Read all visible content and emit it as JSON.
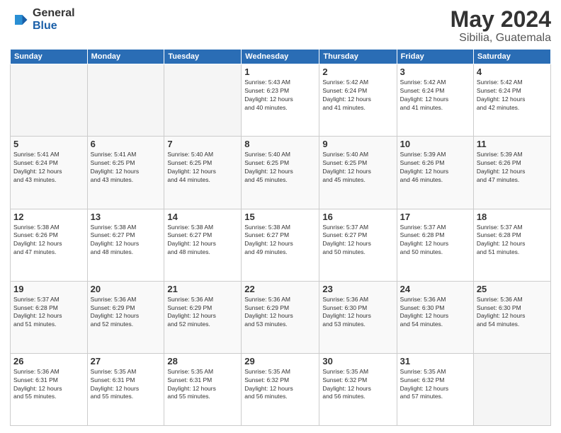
{
  "logo": {
    "general": "General",
    "blue": "Blue"
  },
  "header": {
    "title": "May 2024",
    "subtitle": "Sibilia, Guatemala"
  },
  "weekdays": [
    "Sunday",
    "Monday",
    "Tuesday",
    "Wednesday",
    "Thursday",
    "Friday",
    "Saturday"
  ],
  "weeks": [
    [
      {
        "day": "",
        "info": ""
      },
      {
        "day": "",
        "info": ""
      },
      {
        "day": "",
        "info": ""
      },
      {
        "day": "1",
        "info": "Sunrise: 5:43 AM\nSunset: 6:23 PM\nDaylight: 12 hours\nand 40 minutes."
      },
      {
        "day": "2",
        "info": "Sunrise: 5:42 AM\nSunset: 6:24 PM\nDaylight: 12 hours\nand 41 minutes."
      },
      {
        "day": "3",
        "info": "Sunrise: 5:42 AM\nSunset: 6:24 PM\nDaylight: 12 hours\nand 41 minutes."
      },
      {
        "day": "4",
        "info": "Sunrise: 5:42 AM\nSunset: 6:24 PM\nDaylight: 12 hours\nand 42 minutes."
      }
    ],
    [
      {
        "day": "5",
        "info": "Sunrise: 5:41 AM\nSunset: 6:24 PM\nDaylight: 12 hours\nand 43 minutes."
      },
      {
        "day": "6",
        "info": "Sunrise: 5:41 AM\nSunset: 6:25 PM\nDaylight: 12 hours\nand 43 minutes."
      },
      {
        "day": "7",
        "info": "Sunrise: 5:40 AM\nSunset: 6:25 PM\nDaylight: 12 hours\nand 44 minutes."
      },
      {
        "day": "8",
        "info": "Sunrise: 5:40 AM\nSunset: 6:25 PM\nDaylight: 12 hours\nand 45 minutes."
      },
      {
        "day": "9",
        "info": "Sunrise: 5:40 AM\nSunset: 6:25 PM\nDaylight: 12 hours\nand 45 minutes."
      },
      {
        "day": "10",
        "info": "Sunrise: 5:39 AM\nSunset: 6:26 PM\nDaylight: 12 hours\nand 46 minutes."
      },
      {
        "day": "11",
        "info": "Sunrise: 5:39 AM\nSunset: 6:26 PM\nDaylight: 12 hours\nand 47 minutes."
      }
    ],
    [
      {
        "day": "12",
        "info": "Sunrise: 5:38 AM\nSunset: 6:26 PM\nDaylight: 12 hours\nand 47 minutes."
      },
      {
        "day": "13",
        "info": "Sunrise: 5:38 AM\nSunset: 6:27 PM\nDaylight: 12 hours\nand 48 minutes."
      },
      {
        "day": "14",
        "info": "Sunrise: 5:38 AM\nSunset: 6:27 PM\nDaylight: 12 hours\nand 48 minutes."
      },
      {
        "day": "15",
        "info": "Sunrise: 5:38 AM\nSunset: 6:27 PM\nDaylight: 12 hours\nand 49 minutes."
      },
      {
        "day": "16",
        "info": "Sunrise: 5:37 AM\nSunset: 6:27 PM\nDaylight: 12 hours\nand 50 minutes."
      },
      {
        "day": "17",
        "info": "Sunrise: 5:37 AM\nSunset: 6:28 PM\nDaylight: 12 hours\nand 50 minutes."
      },
      {
        "day": "18",
        "info": "Sunrise: 5:37 AM\nSunset: 6:28 PM\nDaylight: 12 hours\nand 51 minutes."
      }
    ],
    [
      {
        "day": "19",
        "info": "Sunrise: 5:37 AM\nSunset: 6:28 PM\nDaylight: 12 hours\nand 51 minutes."
      },
      {
        "day": "20",
        "info": "Sunrise: 5:36 AM\nSunset: 6:29 PM\nDaylight: 12 hours\nand 52 minutes."
      },
      {
        "day": "21",
        "info": "Sunrise: 5:36 AM\nSunset: 6:29 PM\nDaylight: 12 hours\nand 52 minutes."
      },
      {
        "day": "22",
        "info": "Sunrise: 5:36 AM\nSunset: 6:29 PM\nDaylight: 12 hours\nand 53 minutes."
      },
      {
        "day": "23",
        "info": "Sunrise: 5:36 AM\nSunset: 6:30 PM\nDaylight: 12 hours\nand 53 minutes."
      },
      {
        "day": "24",
        "info": "Sunrise: 5:36 AM\nSunset: 6:30 PM\nDaylight: 12 hours\nand 54 minutes."
      },
      {
        "day": "25",
        "info": "Sunrise: 5:36 AM\nSunset: 6:30 PM\nDaylight: 12 hours\nand 54 minutes."
      }
    ],
    [
      {
        "day": "26",
        "info": "Sunrise: 5:36 AM\nSunset: 6:31 PM\nDaylight: 12 hours\nand 55 minutes."
      },
      {
        "day": "27",
        "info": "Sunrise: 5:35 AM\nSunset: 6:31 PM\nDaylight: 12 hours\nand 55 minutes."
      },
      {
        "day": "28",
        "info": "Sunrise: 5:35 AM\nSunset: 6:31 PM\nDaylight: 12 hours\nand 55 minutes."
      },
      {
        "day": "29",
        "info": "Sunrise: 5:35 AM\nSunset: 6:32 PM\nDaylight: 12 hours\nand 56 minutes."
      },
      {
        "day": "30",
        "info": "Sunrise: 5:35 AM\nSunset: 6:32 PM\nDaylight: 12 hours\nand 56 minutes."
      },
      {
        "day": "31",
        "info": "Sunrise: 5:35 AM\nSunset: 6:32 PM\nDaylight: 12 hours\nand 57 minutes."
      },
      {
        "day": "",
        "info": ""
      }
    ]
  ]
}
